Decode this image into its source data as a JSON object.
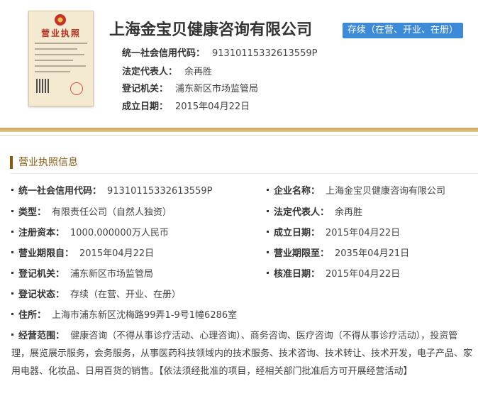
{
  "company": {
    "name": "上海金宝贝健康咨询有限公司",
    "status": "存续（在营、开业、在册）"
  },
  "license_image": {
    "title": "营业执照"
  },
  "summary": [
    {
      "label": "统一社会信用代码：",
      "value": "91310115332613559P"
    },
    {
      "label": "法定代表人：",
      "value": "余再胜"
    },
    {
      "label": "登记机关：",
      "value": "浦东新区市场监管局"
    },
    {
      "label": "成立日期：",
      "value": "2015年04月22日"
    }
  ],
  "section": {
    "title": "营业执照信息"
  },
  "fields": {
    "credit_code": {
      "label": "统一社会信用代码：",
      "value": "91310115332613559P"
    },
    "company_name": {
      "label": "企业名称：",
      "value": "上海金宝贝健康咨询有限公司"
    },
    "type": {
      "label": "类型：",
      "value": "有限责任公司（自然人独资）"
    },
    "legal_rep": {
      "label": "法定代表人：",
      "value": "余再胜"
    },
    "capital": {
      "label": "注册资本：",
      "value": "1000.000000万人民币"
    },
    "established": {
      "label": "成立日期：",
      "value": "2015年04月22日"
    },
    "term_from": {
      "label": "营业期限自：",
      "value": "2015年04月22日"
    },
    "term_to": {
      "label": "营业期限至：",
      "value": "2035年04月21日"
    },
    "authority": {
      "label": "登记机关：",
      "value": "浦东新区市场监管局"
    },
    "approved": {
      "label": "核准日期：",
      "value": "2015年04月22日"
    },
    "reg_status": {
      "label": "登记状态：",
      "value": "存续（在营、开业、在册）"
    },
    "address": {
      "label": "住所：",
      "value": "上海市浦东新区沈梅路99弄1-9号1幢6286室"
    },
    "scope": {
      "label": "经营范围：",
      "value": "健康咨询（不得从事诊疗活动、心理咨询）、商务咨询、医疗咨询（不得从事诊疗活动），投资管理，展览展示服务，会务服务，从事医药科技领域内的技术服务、技术咨询、技术转让、技术开发，电子产品、家用电器、化妆品、日用百货的销售。【依法须经批准的项目，经相关部门批准后方可开展经营活动】"
    }
  },
  "colors": {
    "badge": "#3d8bd8",
    "accent": "#8a5a14",
    "band": "#c8a75a"
  }
}
